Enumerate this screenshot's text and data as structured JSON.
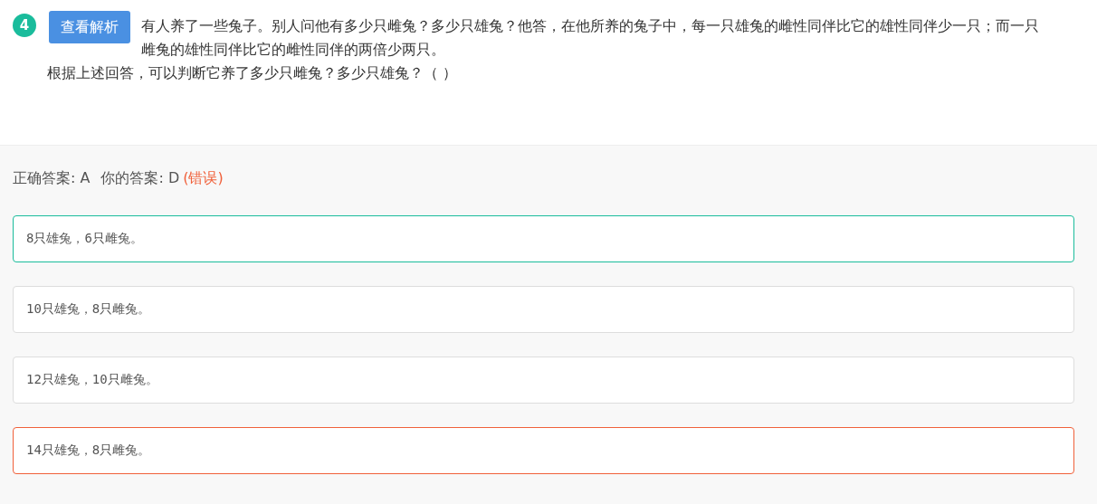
{
  "question": {
    "number": "4",
    "explain_button": "查看解析",
    "text": "有人养了一些兔子。别人问他有多少只雌兔？多少只雄兔？他答，在他所养的兔子中，每一只雄兔的雌性同伴比它的雄性同伴少一只；而一只雌兔的雄性同伴比它的雌性同伴的两倍少两只。",
    "followup": "根据上述回答，可以判断它养了多少只雌兔？多少只雄兔？（    ）"
  },
  "result": {
    "correct_label": "正确答案: A",
    "your_label": "你的答案: D",
    "verdict": "(错误)"
  },
  "options": [
    {
      "text": "8只雄兔，6只雌兔。",
      "correct": true,
      "selected": false
    },
    {
      "text": "10只雄兔，8只雌兔。",
      "correct": false,
      "selected": false
    },
    {
      "text": "12只雄兔，10只雌兔。",
      "correct": false,
      "selected": false
    },
    {
      "text": "14只雄兔，8只雌兔。",
      "correct": false,
      "selected": true
    }
  ]
}
